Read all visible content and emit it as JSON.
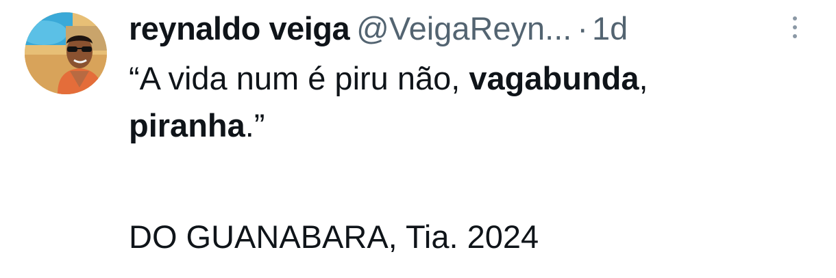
{
  "tweet": {
    "display_name": "reynaldo veiga",
    "handle": "@VeigaReyn...",
    "separator": "·",
    "time_ago": "1d",
    "text_segments": [
      {
        "text": "“A vida num é piru não, ",
        "bold": false
      },
      {
        "text": "vagabunda",
        "bold": true
      },
      {
        "text": ",",
        "bold": false
      },
      {
        "text": "piranha",
        "bold": true
      },
      {
        "text": ".”",
        "bold": false
      }
    ],
    "footer_text": "DO GUANABARA, Tia. 2024",
    "more_icon": "more-vertical-icon",
    "colors": {
      "primary_text": "#0f1419",
      "secondary_text": "#536471",
      "more_dots": "#8b98a5"
    }
  }
}
